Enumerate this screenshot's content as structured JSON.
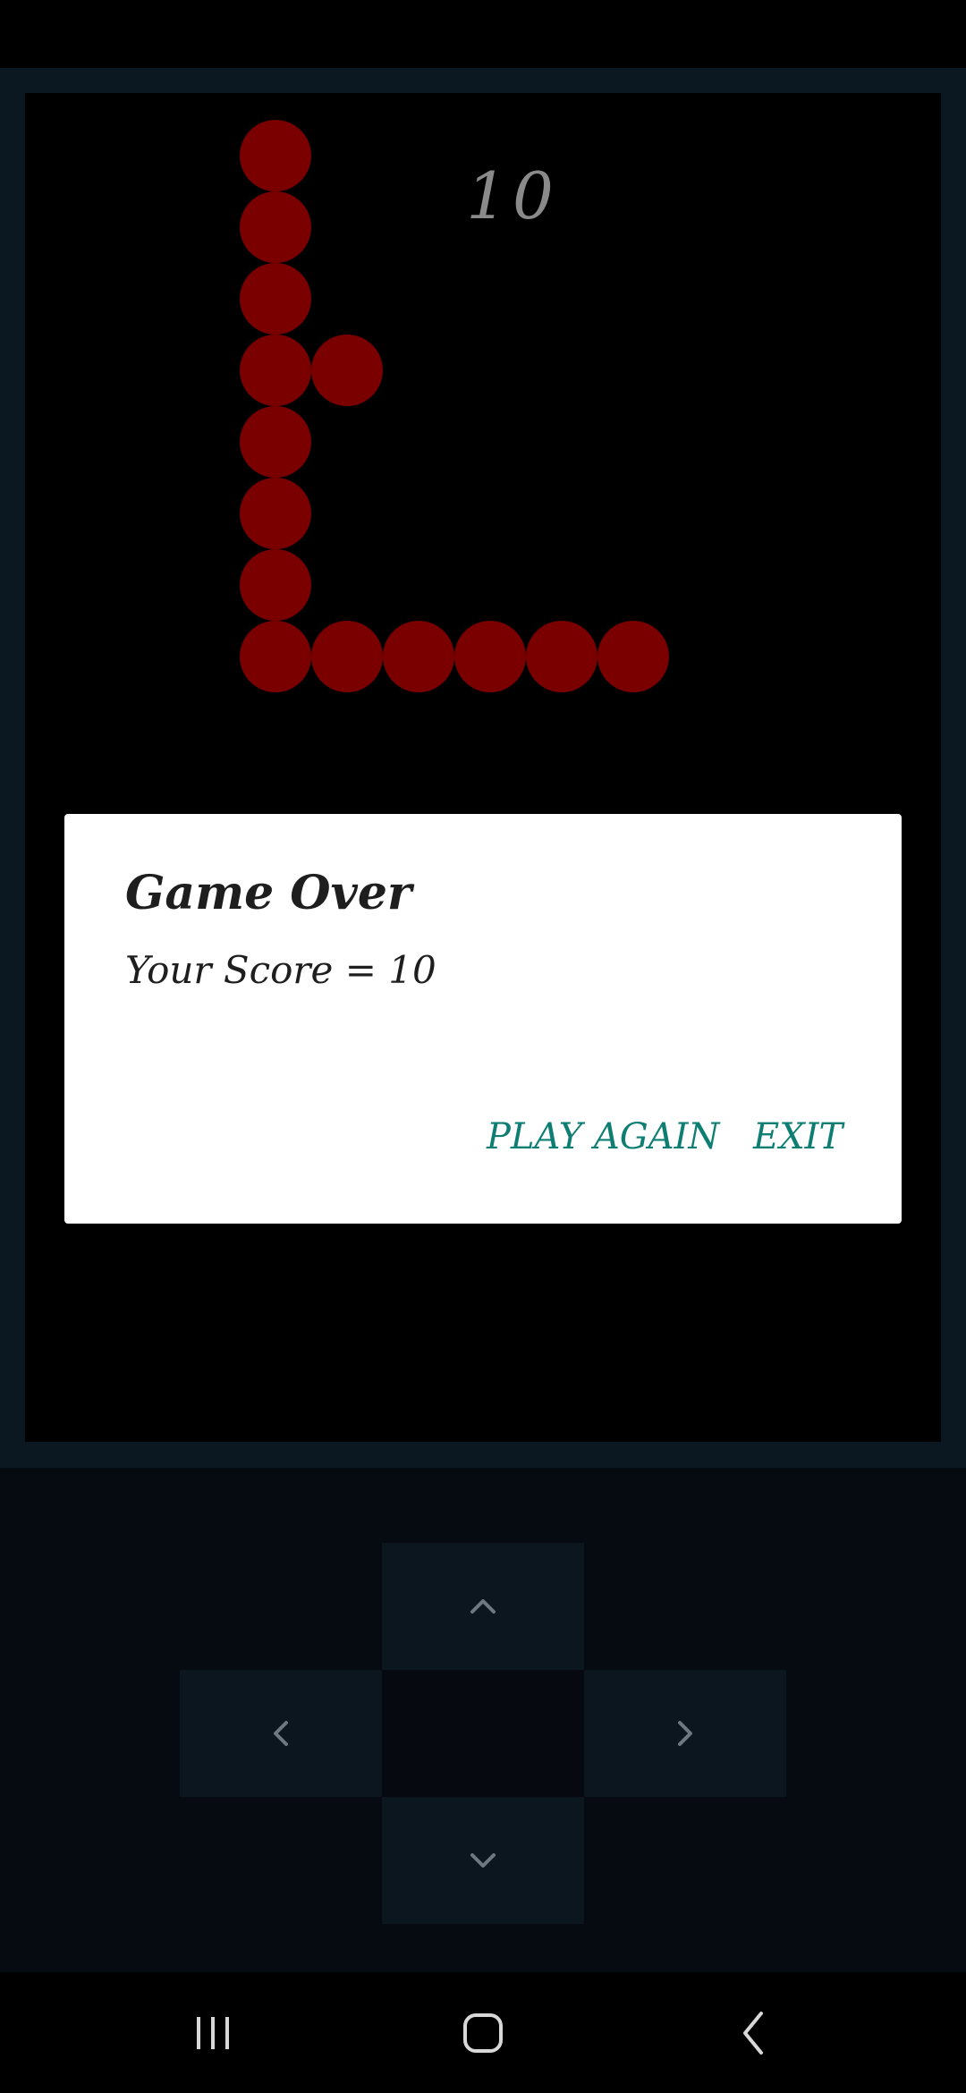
{
  "game": {
    "score": "10",
    "snake_color": "#7a0000",
    "snake_segments": 14
  },
  "dialog": {
    "title": "Game Over",
    "message": "Your Score = 10",
    "play_again_label": "PLAY AGAIN",
    "exit_label": "EXIT",
    "accent_color": "#0e7e73"
  },
  "controls": {
    "up_icon": "chevron-up-icon",
    "left_icon": "chevron-left-icon",
    "right_icon": "chevron-right-icon",
    "down_icon": "chevron-down-icon"
  },
  "navigation_bar": {
    "recents_icon": "recent-apps-icon",
    "home_icon": "home-icon",
    "back_icon": "back-icon"
  }
}
